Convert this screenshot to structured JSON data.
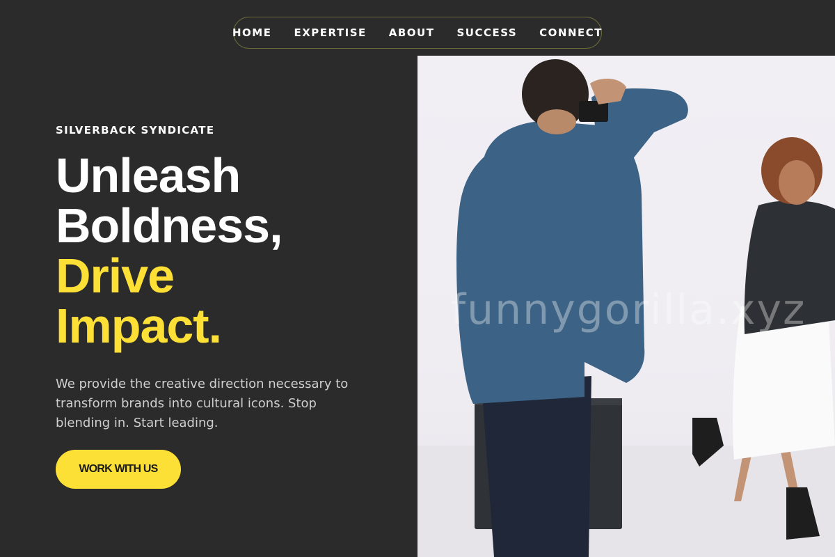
{
  "nav": {
    "items": [
      {
        "label": "HOME"
      },
      {
        "label": "EXPERTISE"
      },
      {
        "label": "ABOUT"
      },
      {
        "label": "SUCCESS"
      },
      {
        "label": "CONNECT"
      }
    ]
  },
  "hero": {
    "eyebrow": "SILVERBACK SYNDICATE",
    "headline": {
      "line1": "Unleash",
      "line2": "Boldness,",
      "line3": "Drive",
      "line4": "Impact."
    },
    "description": "We provide the creative direction necessary to transform brands into cultural icons. Stop blending in. Start leading.",
    "cta_label": "WORK WITH US"
  },
  "photo": {
    "watermark": "funnygorilla.xyz"
  },
  "colors": {
    "background": "#2b2b2b",
    "accent": "#fde036",
    "text": "#ffffff"
  }
}
